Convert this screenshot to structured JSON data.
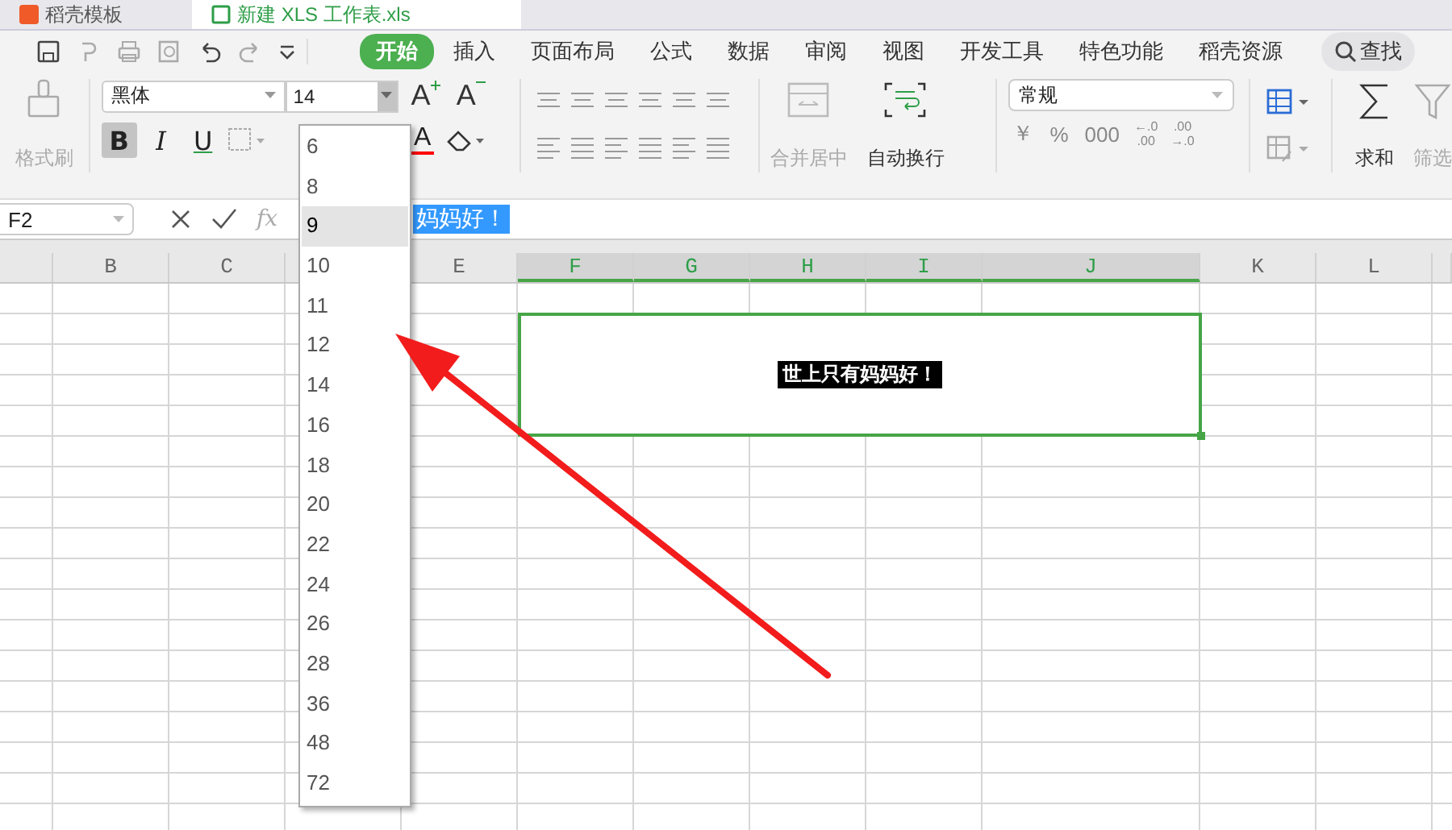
{
  "title_tabs": [
    {
      "label": "稻壳模板",
      "selected": false
    },
    {
      "label": "新建 XLS 工作表.xls",
      "selected": true
    }
  ],
  "menu_tabs": [
    {
      "label": "开始",
      "selected": true
    },
    {
      "label": "插入",
      "selected": false
    },
    {
      "label": "页面布局",
      "selected": false
    },
    {
      "label": "公式",
      "selected": false
    },
    {
      "label": "数据",
      "selected": false
    },
    {
      "label": "审阅",
      "selected": false
    },
    {
      "label": "视图",
      "selected": false
    },
    {
      "label": "开发工具",
      "selected": false
    },
    {
      "label": "特色功能",
      "selected": false
    },
    {
      "label": "稻壳资源",
      "selected": false
    }
  ],
  "search": {
    "label": "查找"
  },
  "ribbon": {
    "format_painter": {
      "label": "格式刷",
      "disabled": true
    },
    "font_name": "黑体",
    "font_size": "14",
    "size_buttons": [
      {
        "kind": "grow",
        "label": "A"
      },
      {
        "kind": "shrink",
        "label": "A"
      }
    ],
    "style_buttons": [
      {
        "kind": "bold",
        "label": "B",
        "on": true
      },
      {
        "kind": "italic",
        "label": "I",
        "on": false
      },
      {
        "kind": "underline",
        "label": "U",
        "on": false
      }
    ],
    "font_color": {
      "label": "A",
      "color": "#ff0000"
    },
    "merge": {
      "label": "合并居中",
      "disabled": true
    },
    "wrap": {
      "label": "自动换行",
      "disabled": false
    },
    "number_format": "常规",
    "number_buttons": [
      "￥",
      "%",
      "000"
    ],
    "decimal_buttons": [
      {
        "top": "←.0",
        "bottom": ".00"
      },
      {
        "top": ".00",
        "bottom": "→.0"
      }
    ],
    "sum": {
      "label": "求和",
      "disabled": false
    },
    "filter": {
      "label": "筛选",
      "disabled": true
    }
  },
  "formula_bar": {
    "name_box": "F2",
    "fx": "fx",
    "value": "妈妈好！"
  },
  "columns": [
    {
      "label": "B",
      "selected": false
    },
    {
      "label": "C",
      "selected": false
    },
    {
      "label": "E",
      "selected": false
    },
    {
      "label": "F",
      "selected": true
    },
    {
      "label": "G",
      "selected": true
    },
    {
      "label": "H",
      "selected": true
    },
    {
      "label": "I",
      "selected": true
    },
    {
      "label": "J",
      "selected": true
    },
    {
      "label": "K",
      "selected": false
    },
    {
      "label": "L",
      "selected": false
    }
  ],
  "cell": {
    "text": "世上只有妈妈好！"
  },
  "font_size_menu": {
    "items": [
      {
        "label": "6",
        "selected": false
      },
      {
        "label": "8",
        "selected": false
      },
      {
        "label": "9",
        "selected": true
      },
      {
        "label": "10",
        "selected": false
      },
      {
        "label": "11",
        "selected": false
      },
      {
        "label": "12",
        "selected": false
      },
      {
        "label": "14",
        "selected": false
      },
      {
        "label": "16",
        "selected": false
      },
      {
        "label": "18",
        "selected": false
      },
      {
        "label": "20",
        "selected": false
      },
      {
        "label": "22",
        "selected": false
      },
      {
        "label": "24",
        "selected": false
      },
      {
        "label": "26",
        "selected": false
      },
      {
        "label": "28",
        "selected": false
      },
      {
        "label": "36",
        "selected": false
      },
      {
        "label": "48",
        "selected": false
      },
      {
        "label": "72",
        "selected": false
      }
    ]
  }
}
